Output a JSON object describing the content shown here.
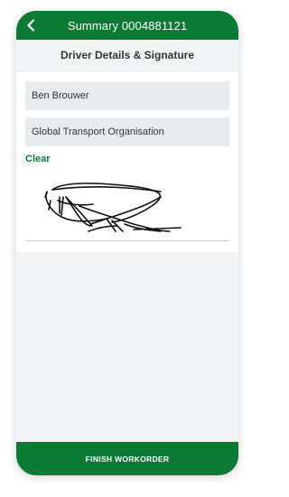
{
  "colors": {
    "brand": "#0b7a34",
    "accent_text": "#0b7a34",
    "page_bg": "#f3f4f5"
  },
  "header": {
    "title": "Summary 0004881121",
    "back_icon": "chevron-left-icon"
  },
  "subheader": {
    "title": "Driver Details & Signature"
  },
  "form": {
    "driver_name": "Ben Brouwer",
    "organisation": "Global Transport Organisation",
    "clear_label": "Clear"
  },
  "footer": {
    "finish_label": "FINISH WORKORDER"
  }
}
